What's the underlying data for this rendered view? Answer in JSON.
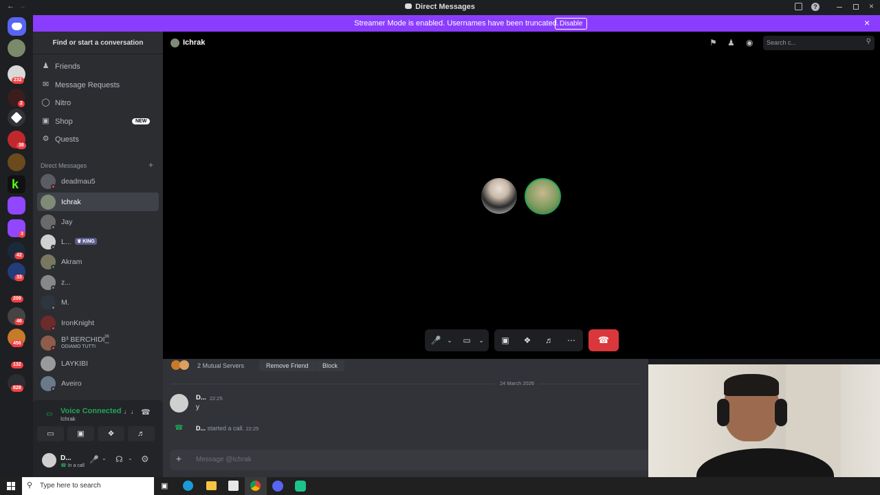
{
  "window": {
    "title": "Direct Messages"
  },
  "banner": {
    "message": "Streamer Mode is enabled. Usernames have been truncated.",
    "button": "Disable"
  },
  "servers": {
    "badges": [
      "232",
      "2",
      "38",
      "3",
      "42",
      "33",
      "209",
      "46",
      "456",
      "132",
      "828"
    ]
  },
  "dm_sidebar": {
    "search_label": "Find or start a conversation",
    "nav": [
      {
        "label": "Friends",
        "icon": "friends-icon"
      },
      {
        "label": "Message Requests",
        "icon": "mail-icon"
      },
      {
        "label": "Nitro",
        "icon": "nitro-icon"
      },
      {
        "label": "Shop",
        "icon": "shop-icon",
        "badge": "NEW"
      },
      {
        "label": "Quests",
        "icon": "quests-icon"
      }
    ],
    "section_title": "Direct Messages",
    "dms": [
      {
        "name": "deadmau5"
      },
      {
        "name": "Ichrak"
      },
      {
        "name": "Jay"
      },
      {
        "name": "L...",
        "tag": "KING"
      },
      {
        "name": "Akram"
      },
      {
        "name": "z..."
      },
      {
        "name": "M."
      },
      {
        "name": "IronKnight"
      },
      {
        "name": "B³ BERCHIDI_",
        "sup": "36",
        "sub": "ODIAMO TUTTI"
      },
      {
        "name": "LAYKIBI"
      },
      {
        "name": "Aveiro"
      }
    ]
  },
  "voice": {
    "status": "Voice Connected",
    "channel": "Ichrak"
  },
  "user": {
    "name": "D...",
    "status": "In a call"
  },
  "header": {
    "name": "Ichrak",
    "search_placeholder": "Search c..."
  },
  "profile_bar": {
    "mutual": "2 Mutual Servers",
    "remove": "Remove Friend",
    "block": "Block"
  },
  "chat": {
    "date": "24 March 2026",
    "messages": [
      {
        "author": "D...",
        "time": "22:25",
        "text": "y"
      }
    ],
    "system": {
      "author": "D...",
      "text": "started a call.",
      "time": "22:25"
    },
    "input_placeholder": "Message @Ichrak"
  },
  "taskbar": {
    "search": "Type here to search"
  },
  "colors": {
    "accent": "#8b3dff",
    "danger": "#da373c",
    "online": "#23a55a"
  }
}
